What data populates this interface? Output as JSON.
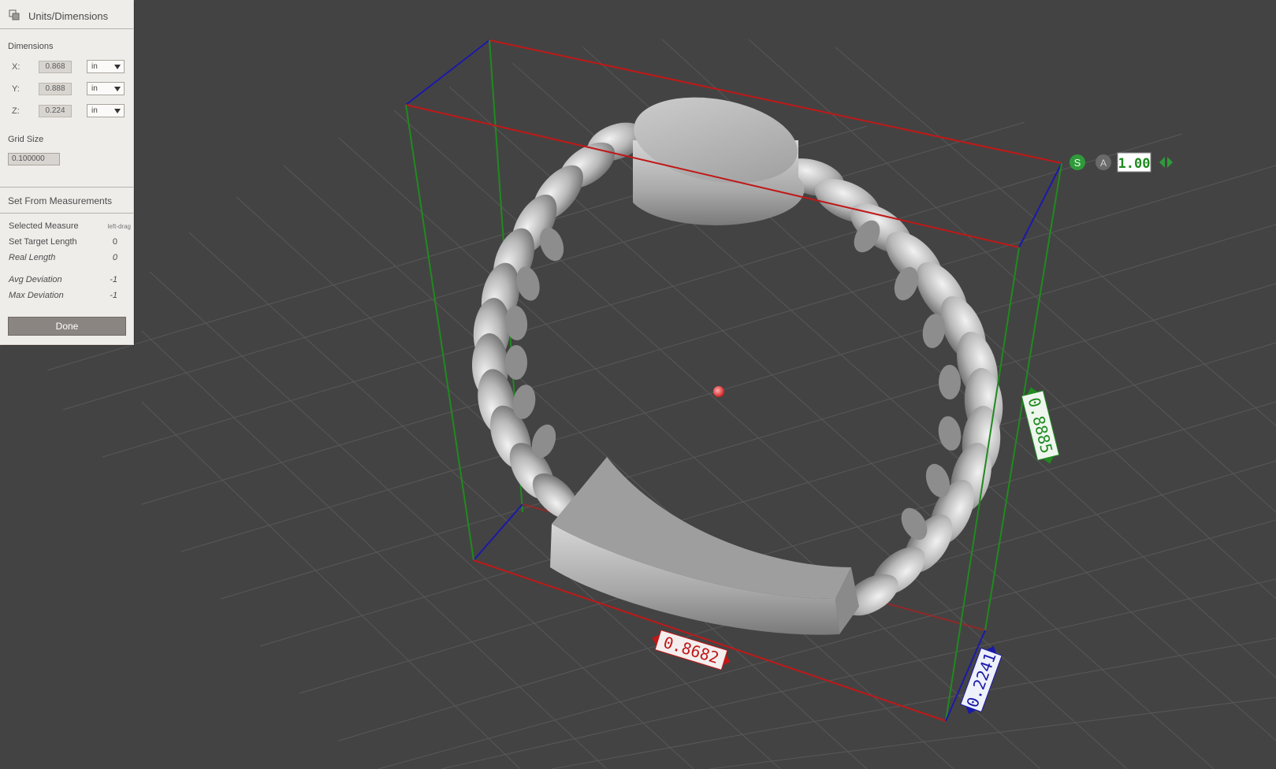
{
  "panel": {
    "title": "Units/Dimensions",
    "dimensions_label": "Dimensions",
    "x": {
      "label": "X:",
      "value": "0.868",
      "unit": "in"
    },
    "y": {
      "label": "Y:",
      "value": "0.888",
      "unit": "in"
    },
    "z": {
      "label": "Z:",
      "value": "0.224",
      "unit": "in"
    },
    "grid_size_label": "Grid Size",
    "grid_size_value": "0.100000",
    "measurements_header": "Set From Measurements",
    "selected_measure": {
      "label": "Selected Measure",
      "value": "left-drag"
    },
    "target_length": {
      "label": "Set Target Length",
      "value": "0"
    },
    "real_length": {
      "label": "Real Length",
      "value": "0"
    },
    "avg_deviation": {
      "label": "Avg Deviation",
      "value": "-1"
    },
    "max_deviation": {
      "label": "Max Deviation",
      "value": "-1"
    },
    "done_label": "Done"
  },
  "viewport": {
    "scale_badge_s": "S",
    "scale_badge_a": "A",
    "scale_value": "1.00",
    "x_dimension_label": "0.8682",
    "y_dimension_label": "0.8885",
    "z_dimension_label": "0.2241",
    "colors": {
      "background": "#444343",
      "x_axis": "#c01818",
      "y_axis": "#1f8a1f",
      "z_axis": "#1a1aa8",
      "model": "#b9b9b9"
    }
  }
}
